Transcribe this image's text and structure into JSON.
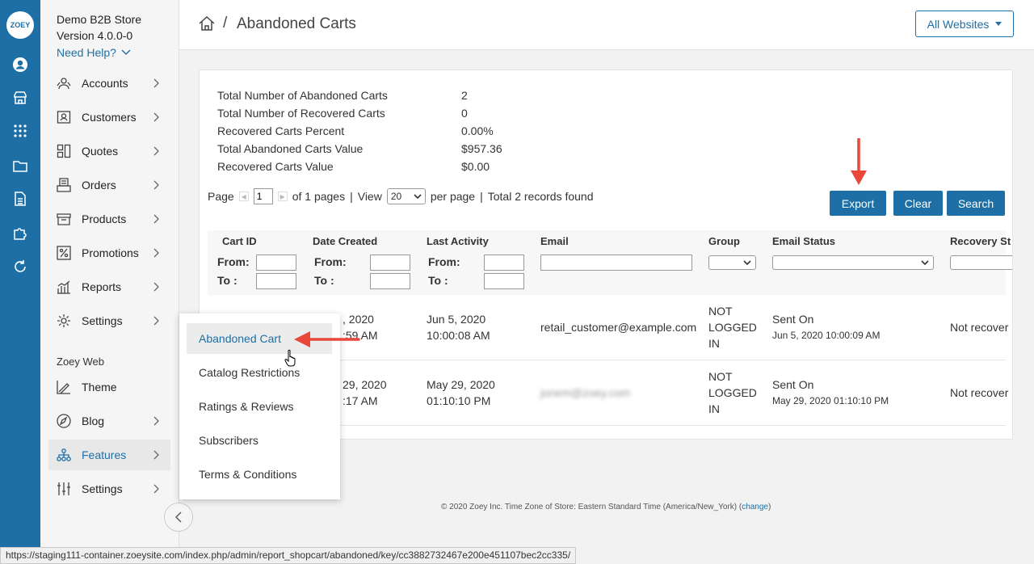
{
  "rail": {
    "logo": "ZOEY",
    "icons": [
      "user-icon",
      "store-icon",
      "apps-grid-icon",
      "folder-icon",
      "document-icon",
      "puzzle-icon",
      "refresh-icon"
    ]
  },
  "nav": {
    "store_name": "Demo B2B Store",
    "version": "Version 4.0.0-0",
    "need_help": "Need Help?",
    "items": [
      {
        "label": "Accounts",
        "icon": "accounts-icon"
      },
      {
        "label": "Customers",
        "icon": "customers-icon"
      },
      {
        "label": "Quotes",
        "icon": "quotes-icon"
      },
      {
        "label": "Orders",
        "icon": "orders-icon"
      },
      {
        "label": "Products",
        "icon": "products-icon"
      },
      {
        "label": "Promotions",
        "icon": "percent-icon"
      },
      {
        "label": "Reports",
        "icon": "reports-icon"
      },
      {
        "label": "Settings",
        "icon": "gear-icon"
      }
    ],
    "section_label": "Zoey Web",
    "web_items": [
      {
        "label": "Theme",
        "icon": "theme-icon"
      },
      {
        "label": "Blog",
        "icon": "blog-icon"
      },
      {
        "label": "Features",
        "icon": "features-icon",
        "active": true
      },
      {
        "label": "Settings",
        "icon": "sliders-icon"
      }
    ]
  },
  "header": {
    "breadcrumb_sep": "/",
    "title": "Abandoned Carts",
    "websites_label": "All Websites"
  },
  "stats": [
    {
      "label": "Total Number of Abandoned Carts",
      "value": "2"
    },
    {
      "label": "Total Number of Recovered Carts",
      "value": "0"
    },
    {
      "label": "Recovered Carts Percent",
      "value": "0.00%"
    },
    {
      "label": "Total Abandoned Carts Value",
      "value": "$957.36"
    },
    {
      "label": "Recovered Carts Value",
      "value": "$0.00"
    }
  ],
  "pager": {
    "page_label": "Page",
    "page_value": "1",
    "of_pages": "of 1 pages",
    "sep1": "|",
    "view_label": "View",
    "per_page_value": "20",
    "per_page_label": "per page",
    "sep2": "|",
    "records_found": "Total 2 records found"
  },
  "buttons": {
    "export": "Export",
    "clear": "Clear",
    "search": "Search"
  },
  "grid": {
    "columns": [
      "Cart ID",
      "Date Created",
      "Last Activity",
      "Email",
      "Group",
      "Email Status",
      "Recovery St"
    ],
    "from_label": "From:",
    "to_label": "To :",
    "rows": [
      {
        "cart_id": "",
        "date_created": [
          ", 2020",
          ":59 AM"
        ],
        "last_activity": [
          "Jun 5, 2020",
          "10:00:08 AM"
        ],
        "email": "retail_customer@example.com",
        "group": [
          "NOT",
          "LOGGED",
          "IN"
        ],
        "email_status": "Sent On",
        "email_status_date": "Jun 5, 2020 10:00:09 AM",
        "recovery": "Not recover"
      },
      {
        "cart_id": "",
        "date_created": [
          "29, 2020",
          ":17 AM"
        ],
        "last_activity": [
          "May 29, 2020",
          "01:10:10 PM"
        ],
        "email": "jonem@zoey.com",
        "group": [
          "NOT",
          "LOGGED",
          "IN"
        ],
        "email_status": "Sent On",
        "email_status_date": "May 29, 2020 01:10:10 PM",
        "recovery": "Not recover"
      }
    ]
  },
  "footer": {
    "text": "© 2020 Zoey Inc. Time Zone of Store: Eastern Standard Time (America/New_York)",
    "change_open": "(",
    "change_link": "change",
    "change_close": ")"
  },
  "flyout": {
    "items": [
      {
        "label": "Abandoned Cart",
        "active": true
      },
      {
        "label": "Catalog Restrictions"
      },
      {
        "label": "Ratings & Reviews"
      },
      {
        "label": "Subscribers"
      },
      {
        "label": "Terms & Conditions"
      }
    ]
  },
  "status_url": "https://staging111-container.zoeysite.com/index.php/admin/report_shopcart/abandoned/key/cc3882732467e200e451107bec2cc335/",
  "colors": {
    "accent": "#1d6fa5",
    "annotation_red": "#e8473a",
    "rail": "#1d6fa5"
  }
}
